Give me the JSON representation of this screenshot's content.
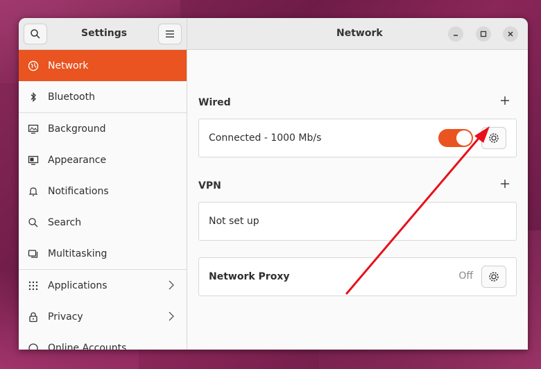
{
  "sidebar_header": {
    "title": "Settings"
  },
  "main_header": {
    "title": "Network"
  },
  "sidebar": {
    "items": [
      {
        "label": "Network",
        "icon": "network-icon",
        "active": true
      },
      {
        "label": "Bluetooth",
        "icon": "bluetooth-icon"
      },
      {
        "label": "Background",
        "icon": "background-icon"
      },
      {
        "label": "Appearance",
        "icon": "appearance-icon"
      },
      {
        "label": "Notifications",
        "icon": "bell-icon"
      },
      {
        "label": "Search",
        "icon": "search-icon"
      },
      {
        "label": "Multitasking",
        "icon": "multitasking-icon"
      },
      {
        "label": "Applications",
        "icon": "grid-icon"
      },
      {
        "label": "Privacy",
        "icon": "lock-icon"
      },
      {
        "label": "Online Accounts",
        "icon": "accounts-icon"
      }
    ]
  },
  "wired": {
    "title": "Wired",
    "status": "Connected - 1000 Mb/s",
    "enabled": true
  },
  "vpn": {
    "title": "VPN",
    "status": "Not set up"
  },
  "proxy": {
    "title": "Network Proxy",
    "state": "Off"
  },
  "colors": {
    "accent": "#e95420",
    "arrow": "#e8101a"
  }
}
